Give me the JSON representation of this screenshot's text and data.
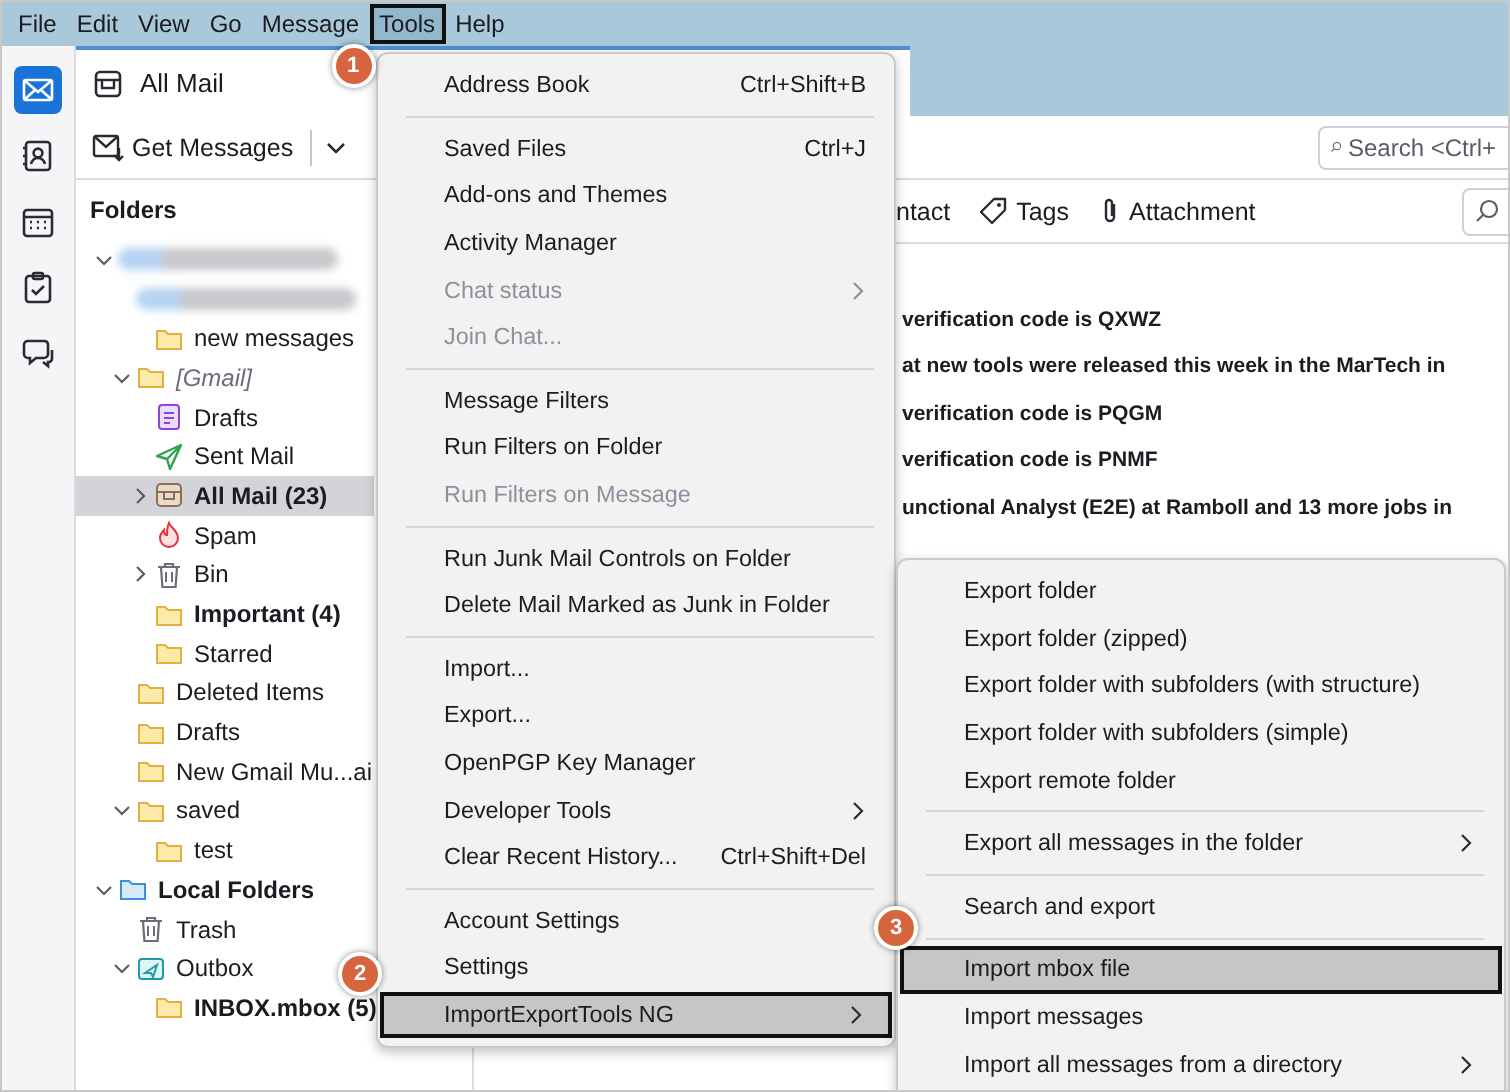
{
  "menubar": [
    {
      "label": "File",
      "selected": false
    },
    {
      "label": "Edit",
      "selected": false
    },
    {
      "label": "View",
      "selected": false
    },
    {
      "label": "Go",
      "selected": false
    },
    {
      "label": "Message",
      "selected": false
    },
    {
      "label": "Tools",
      "selected": true,
      "callout": "1"
    },
    {
      "label": "Help",
      "selected": false
    }
  ],
  "spaces": [
    {
      "kind": "mail",
      "selected": true
    },
    {
      "kind": "contacts",
      "selected": false
    },
    {
      "kind": "calendar",
      "selected": false
    },
    {
      "kind": "tasks",
      "selected": false
    },
    {
      "kind": "chat",
      "selected": false
    }
  ],
  "tab": {
    "label": "All Mail"
  },
  "toolbar": {
    "get_messages": "Get Messages",
    "search": {
      "placeholder": "Search <Ctrl+"
    }
  },
  "folder_pane": {
    "title": "Folders",
    "tree": [
      {
        "kind": "redacted",
        "selected": false,
        "expanded": true,
        "children": [
          {
            "kind": "redacted",
            "selected": false,
            "children": [
              {
                "label": "new messages",
                "kind": "folder",
                "unread": false,
                "selected": false
              }
            ]
          },
          {
            "label": "[Gmail]",
            "kind": "virtual",
            "unread": false,
            "selected": false,
            "expanded": true,
            "children": [
              {
                "label": "Drafts",
                "kind": "drafts",
                "unread": false,
                "selected": false
              },
              {
                "label": "Sent Mail",
                "kind": "sent",
                "unread": false,
                "selected": false
              },
              {
                "label": "All Mail (23)",
                "kind": "allmail",
                "unread": true,
                "selected": true,
                "expanded": false
              },
              {
                "label": "Spam",
                "kind": "spam",
                "unread": false,
                "selected": false
              },
              {
                "label": "Bin",
                "kind": "trash",
                "unread": false,
                "selected": false,
                "expanded": false
              },
              {
                "label": "Important (4)",
                "kind": "folder",
                "unread": true,
                "selected": false
              },
              {
                "label": "Starred",
                "kind": "folder",
                "unread": false,
                "selected": false
              }
            ]
          },
          {
            "label": "Deleted Items",
            "kind": "folder",
            "unread": false,
            "selected": false
          },
          {
            "label": "Drafts",
            "kind": "folder",
            "unread": false,
            "selected": false
          },
          {
            "label": "New Gmail Mu...ai",
            "kind": "folder",
            "unread": false,
            "selected": false
          },
          {
            "label": "saved",
            "kind": "folder",
            "unread": false,
            "selected": false,
            "expanded": true,
            "children": [
              {
                "label": "test",
                "kind": "folder",
                "unread": false,
                "selected": false
              }
            ]
          }
        ]
      },
      {
        "label": "Local Folders",
        "kind": "local",
        "unread": true,
        "selected": false,
        "expanded": true,
        "children": [
          {
            "label": "Trash",
            "kind": "trash",
            "unread": false,
            "selected": false
          },
          {
            "label": "Outbox",
            "kind": "outbox",
            "unread": false,
            "selected": false,
            "expanded": true,
            "children": [
              {
                "label": "INBOX.mbox (5)",
                "kind": "folder",
                "unread": true,
                "selected": false
              }
            ]
          }
        ]
      }
    ]
  },
  "message_pane": {
    "filters": [
      {
        "label": "ntact",
        "kind": "text"
      },
      {
        "label": "Tags",
        "kind": "tags"
      },
      {
        "label": "Attachment",
        "kind": "attachment"
      }
    ],
    "messages": [
      {
        "subject": "verification code is QXWZ"
      },
      {
        "subject": "at new tools were released this week in the MarTech in"
      },
      {
        "subject": "verification code is PQGM"
      },
      {
        "subject": "verification code is PNMF"
      },
      {
        "subject": "unctional Analyst (E2E) at Ramboll and 13 more jobs in"
      }
    ]
  },
  "tools_menu": {
    "items": [
      {
        "kind": "item",
        "label": "Address Book",
        "shortcut": "Ctrl+Shift+B",
        "disabled": false,
        "submenu": false,
        "selected": false
      },
      {
        "kind": "separator"
      },
      {
        "kind": "item",
        "label": "Saved Files",
        "shortcut": "Ctrl+J",
        "disabled": false,
        "submenu": false,
        "selected": false
      },
      {
        "kind": "item",
        "label": "Add-ons and Themes",
        "disabled": false,
        "submenu": false,
        "selected": false
      },
      {
        "kind": "item",
        "label": "Activity Manager",
        "disabled": false,
        "submenu": false,
        "selected": false
      },
      {
        "kind": "item",
        "label": "Chat status",
        "disabled": true,
        "submenu": true,
        "selected": false
      },
      {
        "kind": "item",
        "label": "Join Chat...",
        "disabled": true,
        "submenu": false,
        "selected": false
      },
      {
        "kind": "separator"
      },
      {
        "kind": "item",
        "label": "Message Filters",
        "disabled": false,
        "submenu": false,
        "selected": false
      },
      {
        "kind": "item",
        "label": "Run Filters on Folder",
        "disabled": false,
        "submenu": false,
        "selected": false
      },
      {
        "kind": "item",
        "label": "Run Filters on Message",
        "disabled": true,
        "submenu": false,
        "selected": false
      },
      {
        "kind": "separator"
      },
      {
        "kind": "item",
        "label": "Run Junk Mail Controls on Folder",
        "disabled": false,
        "submenu": false,
        "selected": false
      },
      {
        "kind": "item",
        "label": "Delete Mail Marked as Junk in Folder",
        "disabled": false,
        "submenu": false,
        "selected": false
      },
      {
        "kind": "separator"
      },
      {
        "kind": "item",
        "label": "Import...",
        "disabled": false,
        "submenu": false,
        "selected": false
      },
      {
        "kind": "item",
        "label": "Export...",
        "disabled": false,
        "submenu": false,
        "selected": false
      },
      {
        "kind": "item",
        "label": "OpenPGP Key Manager",
        "disabled": false,
        "submenu": false,
        "selected": false
      },
      {
        "kind": "item",
        "label": "Developer Tools",
        "disabled": false,
        "submenu": true,
        "selected": false
      },
      {
        "kind": "item",
        "label": "Clear Recent History...",
        "shortcut": "Ctrl+Shift+Del",
        "disabled": false,
        "submenu": false,
        "selected": false
      },
      {
        "kind": "separator"
      },
      {
        "kind": "item",
        "label": "Account Settings",
        "disabled": false,
        "submenu": false,
        "selected": false
      },
      {
        "kind": "item",
        "label": "Settings",
        "disabled": false,
        "submenu": false,
        "selected": false
      },
      {
        "kind": "item",
        "label": "ImportExportTools NG",
        "disabled": false,
        "submenu": true,
        "selected": true,
        "callout": "2"
      }
    ]
  },
  "submenu": {
    "items": [
      {
        "kind": "item",
        "label": "Export folder",
        "disabled": false,
        "submenu": false,
        "selected": false
      },
      {
        "kind": "item",
        "label": "Export folder (zipped)",
        "disabled": false,
        "submenu": false,
        "selected": false
      },
      {
        "kind": "item",
        "label": "Export folder with subfolders (with structure)",
        "disabled": false,
        "submenu": false,
        "selected": false
      },
      {
        "kind": "item",
        "label": "Export folder with subfolders (simple)",
        "disabled": false,
        "submenu": false,
        "selected": false
      },
      {
        "kind": "item",
        "label": "Export remote folder",
        "disabled": false,
        "submenu": false,
        "selected": false
      },
      {
        "kind": "separator"
      },
      {
        "kind": "item",
        "label": "Export all messages in the folder",
        "disabled": false,
        "submenu": true,
        "selected": false
      },
      {
        "kind": "separator"
      },
      {
        "kind": "item",
        "label": "Search and export",
        "disabled": false,
        "submenu": false,
        "selected": false
      },
      {
        "kind": "separator"
      },
      {
        "kind": "item",
        "label": "Import mbox file",
        "disabled": false,
        "submenu": false,
        "selected": true,
        "callout": "3"
      },
      {
        "kind": "item",
        "label": "Import messages",
        "disabled": false,
        "submenu": false,
        "selected": false
      },
      {
        "kind": "item",
        "label": "Import all messages from a directory",
        "disabled": false,
        "submenu": true,
        "selected": false
      }
    ]
  }
}
